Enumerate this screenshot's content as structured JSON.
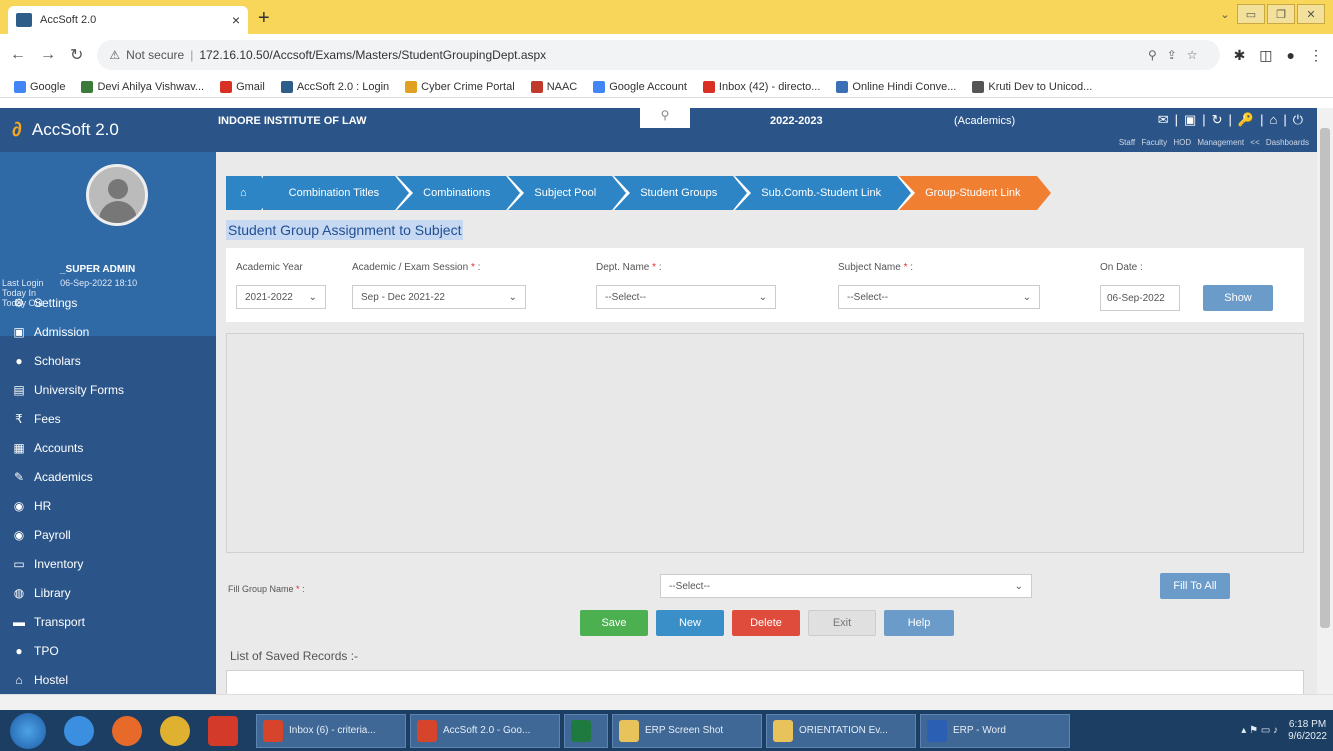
{
  "browser": {
    "tab_title": "AccSoft 2.0",
    "tab_close": "×",
    "new_tab": "+",
    "not_secure": "Not secure",
    "url": "172.16.10.50/Accsoft/Exams/Masters/StudentGroupingDept.aspx",
    "bookmarks": [
      {
        "label": "Google",
        "color": "#4285f4"
      },
      {
        "label": "Devi Ahilya Vishwav...",
        "color": "#3a7a3a"
      },
      {
        "label": "Gmail",
        "color": "#d93025"
      },
      {
        "label": "AccSoft 2.0 : Login",
        "color": "#2f5d8a"
      },
      {
        "label": "Cyber Crime Portal",
        "color": "#e0a020"
      },
      {
        "label": "NAAC",
        "color": "#c0392b"
      },
      {
        "label": "Google Account",
        "color": "#4285f4"
      },
      {
        "label": "Inbox (42) - directo...",
        "color": "#d93025"
      },
      {
        "label": "Online Hindi Conve...",
        "color": "#3b6fb6"
      },
      {
        "label": "Kruti Dev to Unicod...",
        "color": "#555555"
      }
    ]
  },
  "app": {
    "brand": "AccSoft 2.0",
    "institute": "INDORE INSTITUTE OF LAW",
    "year": "2022-2023",
    "module": "(Academics)",
    "top_links": "Staff Faculty HOD Management << Dashboards",
    "user": {
      "name": "_SUPER ADMIN",
      "last_login_label": "Last Login",
      "last_login_value": "06-Sep-2022 18:10",
      "today_in": "Today In",
      "today_out": "Today Out"
    },
    "menu": [
      {
        "label": "Settings",
        "icon": "⚙"
      },
      {
        "label": "Admission",
        "icon": "▣"
      },
      {
        "label": "Scholars",
        "icon": "●"
      },
      {
        "label": "University Forms",
        "icon": "▤"
      },
      {
        "label": "Fees",
        "icon": "₹"
      },
      {
        "label": "Accounts",
        "icon": "▦"
      },
      {
        "label": "Academics",
        "icon": "✎"
      },
      {
        "label": "HR",
        "icon": "◉"
      },
      {
        "label": "Payroll",
        "icon": "◉"
      },
      {
        "label": "Inventory",
        "icon": "▭"
      },
      {
        "label": "Library",
        "icon": "◍"
      },
      {
        "label": "Transport",
        "icon": "▬"
      },
      {
        "label": "TPO",
        "icon": "●"
      },
      {
        "label": "Hostel",
        "icon": "⌂"
      }
    ]
  },
  "wizard": {
    "home": "⌂",
    "steps": [
      "Combination Titles",
      "Combinations",
      "Subject Pool",
      "Student Groups",
      "Sub.Comb.-Student Link",
      "Group-Student Link"
    ]
  },
  "page_title": "Student Group Assignment to Subject",
  "filters": {
    "academic_year_label": "Academic Year",
    "academic_year_value": "2021-2022",
    "session_label": "Academic / Exam Session",
    "session_value": "Sep - Dec 2021-22",
    "dept_label": "Dept. Name",
    "dept_value": "--Select--",
    "subject_label": "Subject Name",
    "subject_value": "--Select--",
    "on_date_label": "On Date :",
    "on_date_value": "06-Sep-2022",
    "show_button": "Show",
    "required_mark": "*",
    "colon": ":"
  },
  "fill": {
    "label": "Fill Group Name",
    "required_mark": "*",
    "colon": ":",
    "select_value": "--Select--",
    "fill_button": "Fill To All"
  },
  "actions": {
    "save": "Save",
    "new": "New",
    "delete": "Delete",
    "exit": "Exit",
    "help": "Help"
  },
  "records_label": "List of Saved Records :-",
  "taskbar": {
    "items": [
      {
        "label": "Inbox (6) - criteria...",
        "color": "#d6452b"
      },
      {
        "label": "AccSoft 2.0 - Goo...",
        "color": "#d6452b"
      },
      {
        "label": "",
        "color": "#1f7a3f"
      },
      {
        "label": "ERP Screen Shot",
        "color": "#e8c25a"
      },
      {
        "label": "ORIENTATION Ev...",
        "color": "#e8c25a"
      },
      {
        "label": "ERP - Word",
        "color": "#2b5fb3"
      }
    ],
    "time": "6:18 PM",
    "date": "9/6/2022"
  }
}
